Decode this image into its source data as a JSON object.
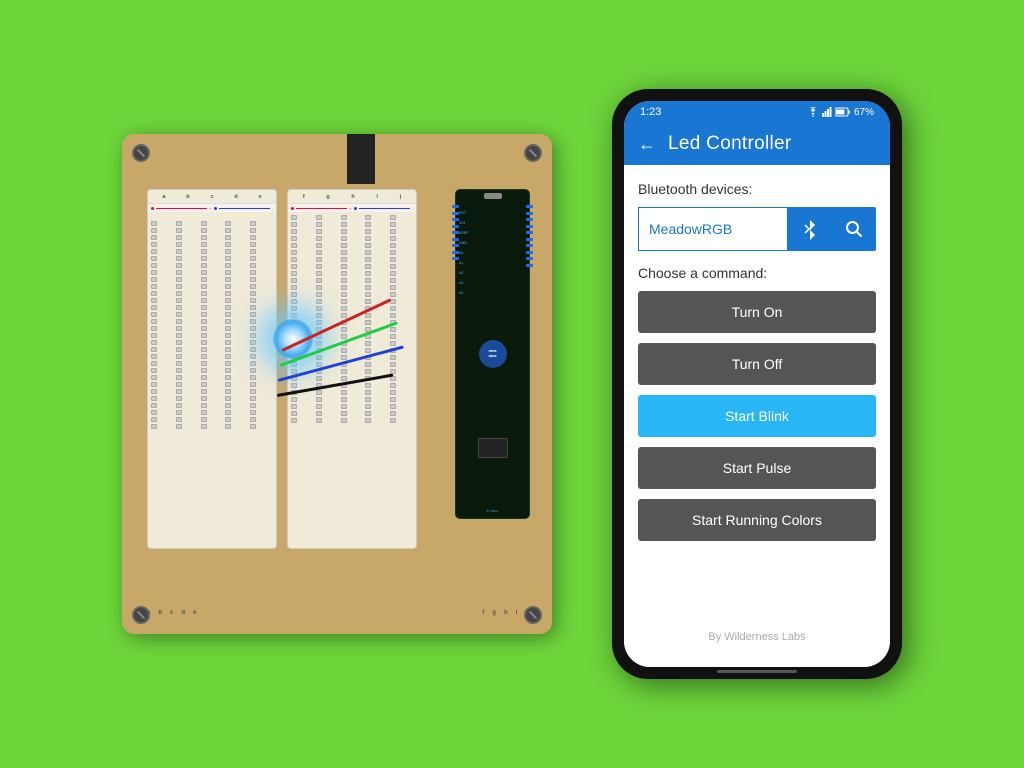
{
  "page": {
    "background_color": "#6dd63b"
  },
  "phone": {
    "status_bar": {
      "time": "1:23",
      "battery": "67%",
      "wifi_icon": "wifi",
      "signal_icon": "signal",
      "battery_icon": "battery"
    },
    "app_bar": {
      "title": "Led Controller",
      "back_label": "←"
    },
    "bluetooth_section": {
      "label": "Bluetooth devices:",
      "device_name": "MeadowRGB",
      "bluetooth_icon": "bluetooth",
      "search_icon": "search"
    },
    "command_section": {
      "label": "Choose a command:",
      "buttons": [
        {
          "id": "turn-on",
          "label": "Turn On",
          "style": "dark"
        },
        {
          "id": "turn-off",
          "label": "Turn Off",
          "style": "dark"
        },
        {
          "id": "start-blink",
          "label": "Start Blink",
          "style": "blue"
        },
        {
          "id": "start-pulse",
          "label": "Start Pulse",
          "style": "dark"
        },
        {
          "id": "start-running-colors",
          "label": "Start Running Colors",
          "style": "dark"
        }
      ]
    },
    "footer": {
      "text": "By Wilderness Labs"
    }
  },
  "hardware": {
    "board": "Meadow F7 Micro",
    "description": "RGB LED on breadboard"
  }
}
